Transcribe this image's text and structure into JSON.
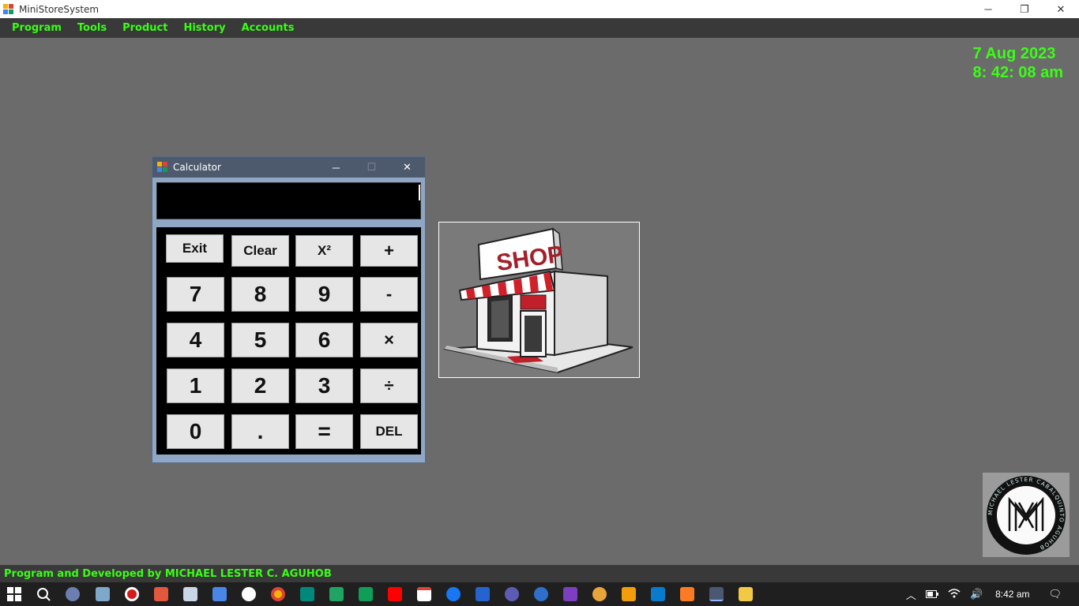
{
  "window": {
    "title": "MiniStoreSystem",
    "minimize": "─",
    "restore": "❐",
    "close": "✕"
  },
  "menu": [
    "Program",
    "Tools",
    "Product",
    "History",
    "Accounts"
  ],
  "clock": {
    "date": "7 Aug 2023",
    "time": "8: 42: 08 am"
  },
  "calculator": {
    "title": "Calculator",
    "minimize": "─",
    "maximize": "☐",
    "close": "✕",
    "display_value": "",
    "rows": [
      [
        "Exit",
        "Clear",
        "X²",
        "+"
      ],
      [
        "7",
        "8",
        "9",
        "-"
      ],
      [
        "4",
        "5",
        "6",
        "×"
      ],
      [
        "1",
        "2",
        "3",
        "÷"
      ],
      [
        "0",
        ".",
        "=",
        "DEL"
      ]
    ]
  },
  "shop_image": {
    "sign": "SHOP"
  },
  "logo": {
    "ring_text": "MICHAEL LESTER CABALQUINTO AGUHOB"
  },
  "footer": {
    "credit": "Program and Developed by MICHAEL LESTER C. AGUHOB"
  },
  "taskbar": {
    "time": "8:42 am",
    "tray": {
      "chevron": "︿",
      "volume": "🔊",
      "notifications": "🗨"
    },
    "apps": [
      "windows-start",
      "search",
      "settings",
      "monitor",
      "record",
      "app",
      "notepad",
      "translate",
      "google",
      "chrome",
      "meet",
      "drive",
      "sheets",
      "youtube",
      "gmail",
      "facebook",
      "todo",
      "app",
      "app",
      "visual-studio",
      "app",
      "sublime",
      "vscode",
      "xampp",
      "app",
      "file-explorer"
    ]
  },
  "colors": {
    "accent_green": "#39ff14",
    "menu_bg": "#393939",
    "desktop_bg": "#6b6b6b"
  }
}
